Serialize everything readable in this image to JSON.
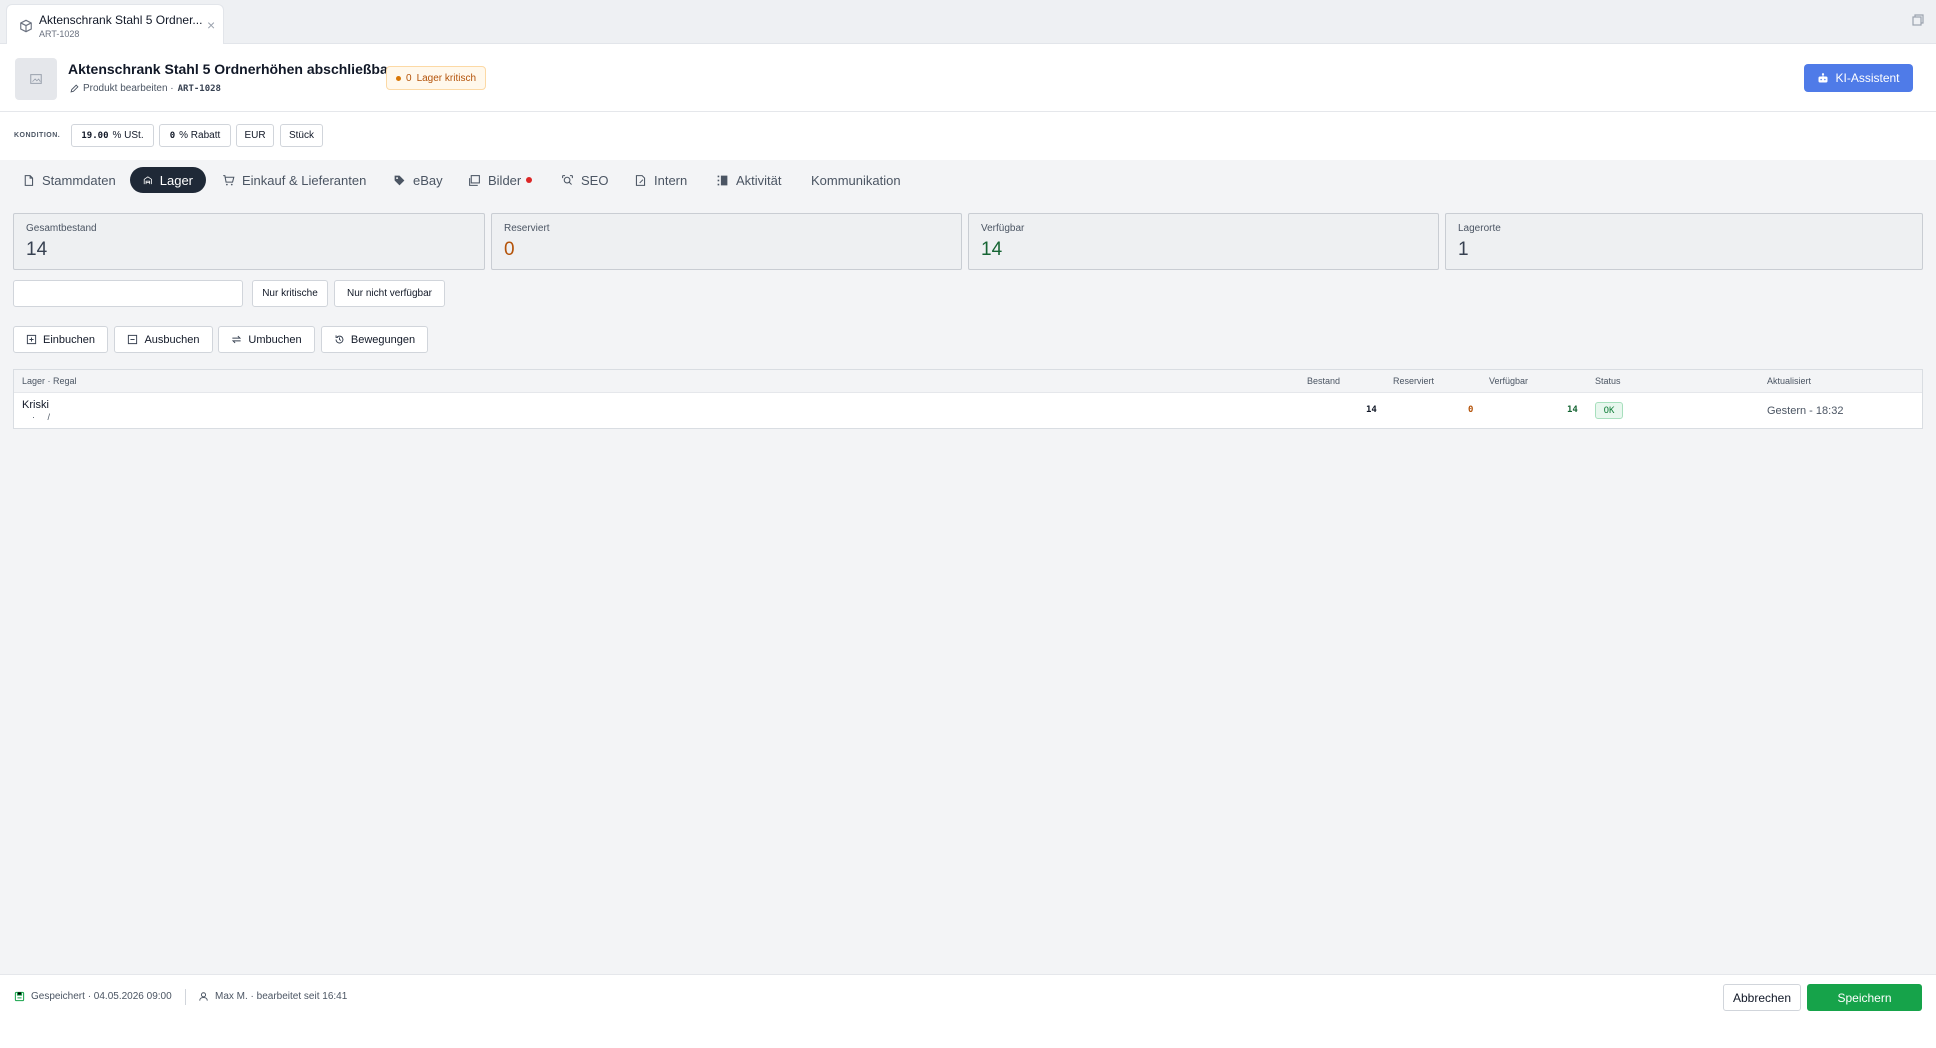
{
  "window_tab": {
    "title": "Aktenschrank Stahl 5 Ordner...",
    "subtitle": "ART-1028",
    "close": "×"
  },
  "header": {
    "title": "Aktenschrank Stahl 5 Ordnerhöhen abschließbar",
    "edit_label": "Produkt bearbeiten ·",
    "sku": "ART-1028",
    "stock_badge_count": "0",
    "stock_badge_label": "Lager kritisch",
    "ki_button": "KI-Assistent"
  },
  "conditions": {
    "label": "KONDITION.",
    "vat_value": "19.00",
    "vat_unit": "% USt.",
    "discount_value": "0",
    "discount_unit": "% Rabatt",
    "currency": "EUR",
    "unit": "Stück"
  },
  "tabs": [
    {
      "label": "Stammdaten",
      "icon": "document-icon"
    },
    {
      "label": "Lager",
      "icon": "warehouse-icon",
      "active": true
    },
    {
      "label": "Einkauf & Lieferanten",
      "icon": "cart-icon"
    },
    {
      "label": "eBay",
      "icon": "tag-icon"
    },
    {
      "label": "Bilder",
      "icon": "images-icon",
      "dot": true
    },
    {
      "label": "SEO",
      "icon": "seo-icon"
    },
    {
      "label": "Intern",
      "icon": "note-icon"
    },
    {
      "label": "Aktivität",
      "icon": "activity-icon"
    },
    {
      "label": "Kommunikation",
      "icon": ""
    }
  ],
  "kpis": [
    {
      "label": "Gesamtbestand",
      "value": "14",
      "color": "#374151"
    },
    {
      "label": "Reserviert",
      "value": "0",
      "color": "#b45309"
    },
    {
      "label": "Verfügbar",
      "value": "14",
      "color": "#166534"
    },
    {
      "label": "Lagerorte",
      "value": "1",
      "color": "#374151"
    }
  ],
  "filters": {
    "search_placeholder": "",
    "only_critical": "Nur kritische",
    "only_unavailable": "Nur nicht verfügbar"
  },
  "actions": {
    "book_in": "Einbuchen",
    "book_out": "Ausbuchen",
    "rebook": "Umbuchen",
    "movements": "Bewegungen"
  },
  "table": {
    "headers": {
      "location": "Lager · Regal",
      "stock": "Bestand",
      "reserved": "Reserviert",
      "available": "Verfügbar",
      "status": "Status",
      "updated": "Aktualisiert"
    },
    "rows": [
      {
        "warehouse": "Kriski",
        "shelf": "·     /",
        "stock": "14",
        "reserved": "0",
        "available": "14",
        "status": "OK",
        "updated": "Gestern - 18:32"
      }
    ]
  },
  "footer": {
    "saved": "Gespeichert · 04.05.2026 09:00",
    "editor": "Max M. · bearbeitet seit 16:41",
    "cancel": "Abbrechen",
    "save": "Speichern"
  },
  "colors": {
    "primary": "#4f7be8",
    "success": "#16a34a",
    "warning": "#b45309",
    "active_tab": "#1f2937"
  }
}
